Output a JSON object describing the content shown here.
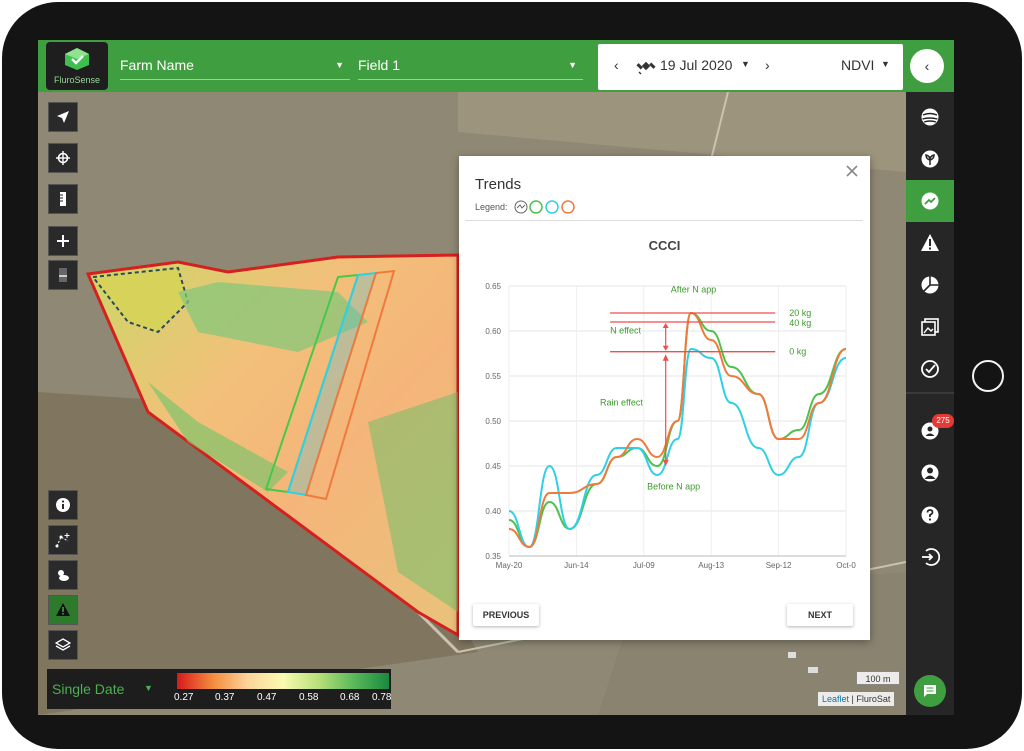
{
  "app": {
    "logo_text": "FluroSense",
    "farm": "Farm Name",
    "field": "Field 1",
    "date": "19 Jul 2020",
    "layer": "NDVI",
    "nav_prev": "‹",
    "nav_next": "›",
    "collapse": "‹"
  },
  "sidebar": {
    "items": [
      "globe-icon",
      "plant-icon",
      "trends-icon",
      "alert-icon",
      "pie-chart-icon",
      "images-icon",
      "check-badge-icon",
      "users-icon",
      "profile-icon",
      "help-icon",
      "logout-icon"
    ],
    "active": "trends-icon",
    "notification_count": "275"
  },
  "legend": {
    "mode": "Single Date",
    "ticks": [
      "0.27",
      "0.37",
      "0.47",
      "0.58",
      "0.68",
      "0.78"
    ]
  },
  "map": {
    "scale": "100 m",
    "attribution_link": "Leaflet",
    "attribution_sep": " | ",
    "attribution_text": "FluroSat"
  },
  "dialog": {
    "title": "Trends",
    "legend_label": "Legend:",
    "chart_title": "CCCI",
    "previous": "PREVIOUS",
    "next": "NEXT"
  },
  "colors": {
    "brand_green": "#3f9e3f",
    "series_green": "#4cc24c",
    "series_cyan": "#2fd0e6",
    "series_orange": "#f07a3c",
    "annotation_red": "#ef4e4e",
    "annotation_green": "#3d9a2d"
  },
  "chart_data": {
    "type": "line",
    "title": "CCCI",
    "x_ticks": [
      "May-20",
      "Jun-14",
      "Jul-09",
      "Aug-13",
      "Sep-12",
      "Oct-0"
    ],
    "ylim": [
      0.35,
      0.65
    ],
    "y_ticks": [
      "0.35",
      "0.40",
      "0.45",
      "0.50",
      "0.55",
      "0.60",
      "0.65"
    ],
    "x_domain": [
      0,
      100
    ],
    "series": [
      {
        "color": "green",
        "points": [
          [
            0,
            0.39
          ],
          [
            6,
            0.36
          ],
          [
            12,
            0.41
          ],
          [
            18,
            0.38
          ],
          [
            26,
            0.43
          ],
          [
            32,
            0.46
          ],
          [
            38,
            0.47
          ],
          [
            44,
            0.45
          ],
          [
            50,
            0.5
          ],
          [
            54,
            0.62
          ],
          [
            60,
            0.6
          ],
          [
            66,
            0.56
          ],
          [
            74,
            0.53
          ],
          [
            80,
            0.48
          ],
          [
            86,
            0.49
          ],
          [
            92,
            0.53
          ],
          [
            100,
            0.58
          ]
        ]
      },
      {
        "color": "cyan",
        "points": [
          [
            0,
            0.4
          ],
          [
            6,
            0.36
          ],
          [
            12,
            0.45
          ],
          [
            18,
            0.38
          ],
          [
            26,
            0.44
          ],
          [
            32,
            0.47
          ],
          [
            38,
            0.47
          ],
          [
            44,
            0.44
          ],
          [
            50,
            0.48
          ],
          [
            54,
            0.58
          ],
          [
            60,
            0.57
          ],
          [
            66,
            0.52
          ],
          [
            74,
            0.47
          ],
          [
            80,
            0.44
          ],
          [
            86,
            0.46
          ],
          [
            92,
            0.52
          ],
          [
            100,
            0.57
          ]
        ]
      },
      {
        "color": "orange",
        "points": [
          [
            0,
            0.38
          ],
          [
            6,
            0.36
          ],
          [
            12,
            0.42
          ],
          [
            18,
            0.42
          ],
          [
            26,
            0.43
          ],
          [
            32,
            0.46
          ],
          [
            38,
            0.48
          ],
          [
            44,
            0.46
          ],
          [
            50,
            0.5
          ],
          [
            54,
            0.62
          ],
          [
            60,
            0.59
          ],
          [
            66,
            0.55
          ],
          [
            74,
            0.53
          ],
          [
            80,
            0.48
          ],
          [
            86,
            0.48
          ],
          [
            92,
            0.52
          ],
          [
            100,
            0.58
          ]
        ]
      }
    ],
    "annotations": {
      "after_n_app": "After N app",
      "n_effect": "N effect",
      "rain_effect": "Rain effect",
      "before_n_app": "Before N app",
      "level_20kg": "20 kg",
      "level_40kg": "40 kg",
      "level_0kg": "0 kg",
      "level_values": [
        0.62,
        0.61,
        0.577
      ]
    }
  }
}
